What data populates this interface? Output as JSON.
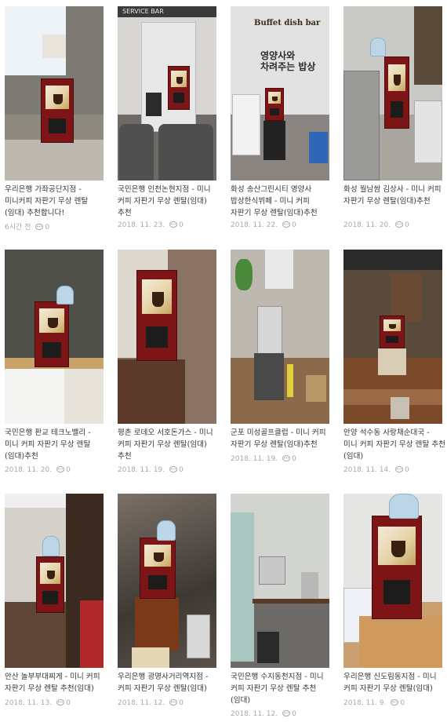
{
  "colors": {
    "title_text": "#333333",
    "meta_text": "#a8a8a8",
    "machine_red": "#7d1516"
  },
  "posts": [
    {
      "title": "우리은행 가좌공단지점 - 미니커피 자판기 무상 렌탈(임대) 추천합니다!",
      "date": "6시간 전",
      "comments": "0"
    },
    {
      "title": "국민은행 인천논현지점 - 미니 커피 자판기 무상 렌탈(임대) 추천",
      "date": "2018. 11. 23.",
      "comments": "0"
    },
    {
      "title": "화성 송산그린시티 영양사 밥상한식뷔페 - 미니 커피 자판기 무상 렌탈(임대)추천",
      "date": "2018. 11. 22.",
      "comments": "0"
    },
    {
      "title": "화성 월남쌈 김상사 - 미니 커피 자판기 무상 렌탈(임대)추천",
      "date": "2018. 11. 20.",
      "comments": "0"
    },
    {
      "title": "국민은행 판교 테크노밸리 - 미니 커피 자판기 무상 렌탈(임대)추천",
      "date": "2018. 11. 20.",
      "comments": "0"
    },
    {
      "title": "평촌 로데오 서호돈가스 - 미니 커피 자판기 무상 렌탈(임대) 추천",
      "date": "2018. 11. 19.",
      "comments": "0"
    },
    {
      "title": "군포 미성골프클럽 - 미니 커피 자판기 무상 렌탈(임대)추천",
      "date": "2018. 11. 19.",
      "comments": "0"
    },
    {
      "title": "안양 석수동 사랑채순대국 - 미니 커피 자판기 무상 렌탈 추천(임대)",
      "date": "2018. 11. 14.",
      "comments": "0"
    },
    {
      "title": "안산 놀부부대찌게 - 미니 커피 자판기 무상 렌탈 추천(임대)",
      "date": "2018. 11. 13.",
      "comments": "0"
    },
    {
      "title": "우리은행 광명사거리역지점 - 커피 자판기 무상 렌탈(임대)",
      "date": "2018. 11. 12.",
      "comments": "0"
    },
    {
      "title": "국민은행 수지동천지점 - 미니 커피 자판기 무상 렌탈 추천(임대)",
      "date": "2018. 11. 12.",
      "comments": "0"
    },
    {
      "title": "우리은행 신도림동지점 - 미니 커피 자판기 무상 렌탈(임대)",
      "date": "2018. 11. 9.",
      "comments": "0"
    }
  ],
  "photo_signage": {
    "banner_top": "SERVICE BAR",
    "buffet_sign": "Buffet dish bar",
    "korean_sign": "영양사와 차려주는 밥상"
  }
}
